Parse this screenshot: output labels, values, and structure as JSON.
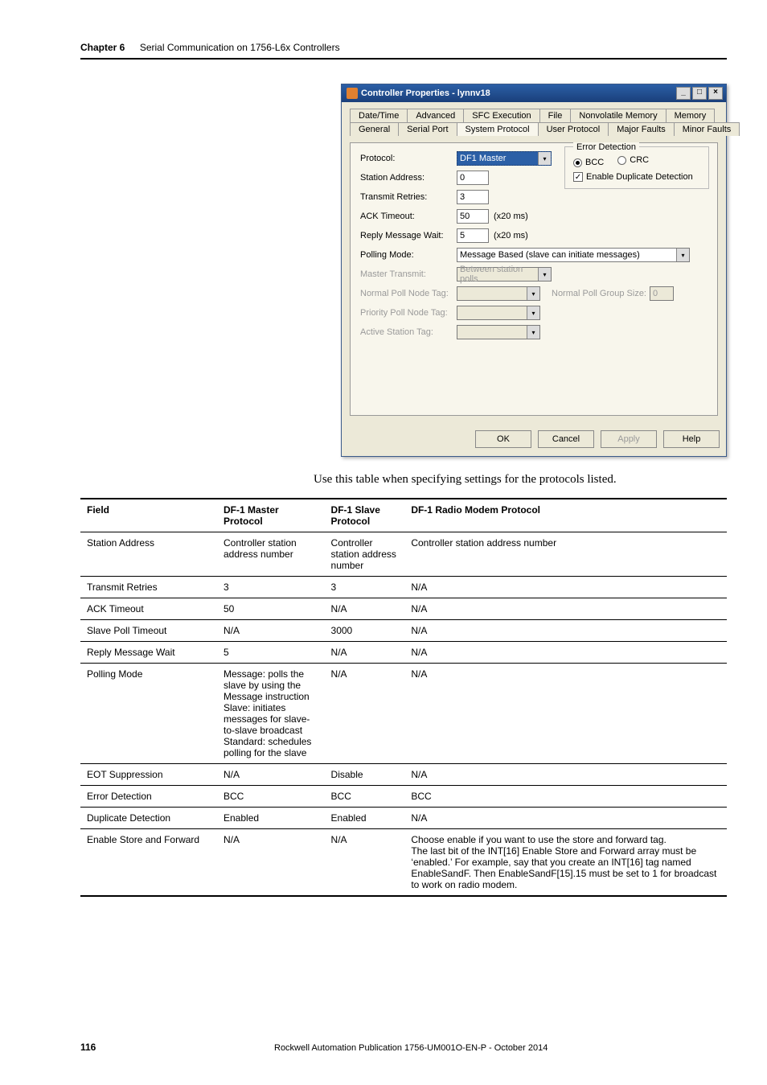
{
  "header": {
    "chapter_label": "Chapter 6",
    "chapter_title": "Serial Communication on 1756-L6x Controllers"
  },
  "dialog": {
    "title": "Controller Properties - lynnv18",
    "win_min": "_",
    "win_max": "□",
    "win_close": "×",
    "tabs_row1": [
      "Date/Time",
      "Advanced",
      "SFC Execution",
      "File",
      "Nonvolatile Memory",
      "Memory"
    ],
    "tabs_row2": [
      "General",
      "Serial Port",
      "System Protocol",
      "User Protocol",
      "Major Faults",
      "Minor Faults"
    ],
    "active_tab_row": 1,
    "active_tab_index": 2,
    "labels": {
      "protocol": "Protocol:",
      "station_address": "Station Address:",
      "transmit_retries": "Transmit Retries:",
      "ack_timeout": "ACK Timeout:",
      "reply_message_wait": "Reply Message Wait:",
      "polling_mode": "Polling Mode:",
      "master_transmit": "Master Transmit:",
      "normal_poll_node_tag": "Normal Poll Node Tag:",
      "normal_poll_group_size": "Normal Poll Group Size:",
      "priority_poll_node_tag": "Priority Poll Node Tag:",
      "active_station_tag": "Active Station Tag:"
    },
    "values": {
      "protocol": "DF1 Master",
      "station_address": "0",
      "transmit_retries": "3",
      "ack_timeout": "50",
      "ack_timeout_suffix": "(x20 ms)",
      "reply_message_wait": "5",
      "reply_message_wait_suffix": "(x20 ms)",
      "polling_mode": "Message Based (slave can initiate messages)",
      "master_transmit": "Between station polls",
      "normal_poll_node_tag": "",
      "normal_poll_group_size": "0",
      "priority_poll_node_tag": "",
      "active_station_tag": ""
    },
    "error_detection": {
      "legend": "Error Detection",
      "opt_bcc": "BCC",
      "opt_crc": "CRC",
      "selected": "BCC",
      "enable_dup": "Enable Duplicate Detection",
      "enable_dup_checked": true
    },
    "buttons": {
      "ok": "OK",
      "cancel": "Cancel",
      "apply": "Apply",
      "help": "Help"
    }
  },
  "body_text": "Use this table when specifying settings for the protocols listed.",
  "table": {
    "headers": [
      "Field",
      "DF-1 Master Protocol",
      "DF-1 Slave Protocol",
      "DF-1 Radio Modem Protocol"
    ],
    "rows": [
      [
        "Station Address",
        "Controller station address number",
        "Controller station address number",
        "Controller station address number"
      ],
      [
        "Transmit Retries",
        "3",
        "3",
        "N/A"
      ],
      [
        "ACK Timeout",
        "50",
        "N/A",
        "N/A"
      ],
      [
        "Slave Poll Timeout",
        "N/A",
        "3000",
        "N/A"
      ],
      [
        "Reply Message Wait",
        "5",
        "N/A",
        "N/A"
      ],
      [
        "Polling Mode",
        "Message: polls the slave by using the Message instruction\nSlave: initiates messages for slave-to-slave broadcast\nStandard: schedules polling for the slave",
        "N/A",
        "N/A"
      ],
      [
        "EOT Suppression",
        "N/A",
        "Disable",
        "N/A"
      ],
      [
        "Error Detection",
        "BCC",
        "BCC",
        "BCC"
      ],
      [
        "Duplicate Detection",
        "Enabled",
        "Enabled",
        "N/A"
      ],
      [
        "Enable Store and Forward",
        "N/A",
        "N/A",
        "Choose enable if you want to use the store and forward tag.\nThe last bit of the INT[16] Enable Store and Forward array must be ‘enabled.’ For example, say that you create an INT[16] tag named EnableSandF. Then EnableSandF[15].15 must be set to 1 for broadcast to work on radio modem."
      ]
    ]
  },
  "footer": {
    "page": "116",
    "pub": "Rockwell Automation Publication 1756-UM001O-EN-P - October 2014"
  }
}
